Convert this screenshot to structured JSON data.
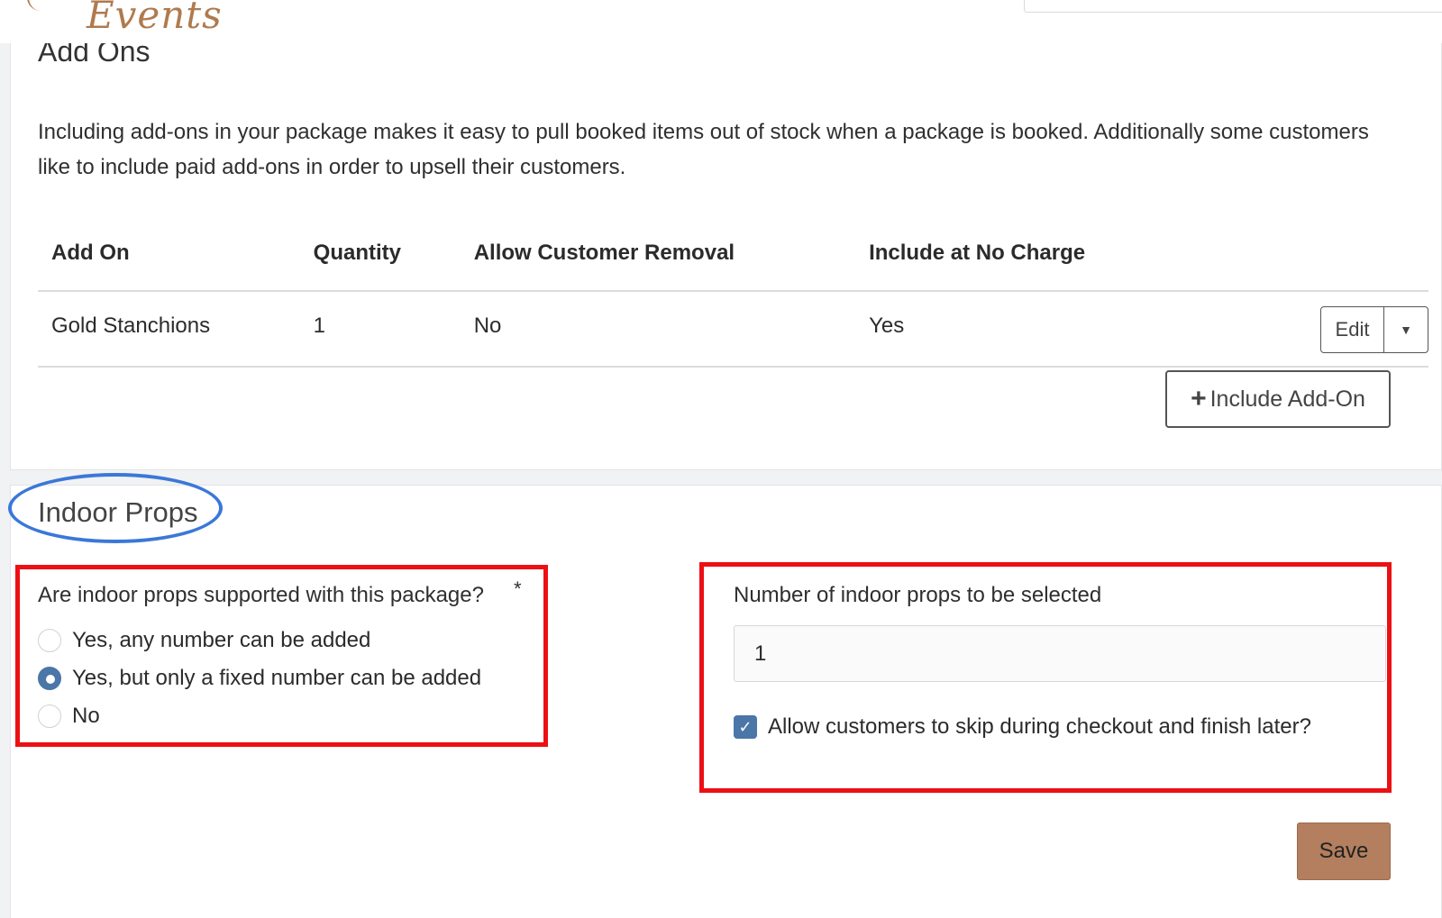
{
  "header": {
    "logo_text": "Events"
  },
  "addons": {
    "title": "Add Ons",
    "description": "Including add-ons in your package makes it easy to pull booked items out of stock when a package is booked. Additionally some customers like to include paid add-ons in order to upsell their customers.",
    "columns": [
      "Add On",
      "Quantity",
      "Allow Customer Removal",
      "Include at No Charge"
    ],
    "rows": [
      {
        "name": "Gold Stanchions",
        "quantity": "1",
        "allow_removal": "No",
        "no_charge": "Yes"
      }
    ],
    "edit_label": "Edit",
    "include_label": "Include Add-On"
  },
  "indoor_props": {
    "title": "Indoor Props",
    "question": "Are indoor props supported with this package?",
    "required_marker": "*",
    "options": [
      {
        "label": "Yes, any number can be added",
        "selected": false
      },
      {
        "label": "Yes, but only a fixed number can be added",
        "selected": true
      },
      {
        "label": "No",
        "selected": false
      }
    ],
    "number_label": "Number of indoor props to be selected",
    "number_value": "1",
    "skip_label": "Allow customers to skip during checkout and finish later?",
    "skip_checked": true,
    "save_label": "Save"
  },
  "colors": {
    "accent": "#4a76a8",
    "save_button": "#b37f5e",
    "annotation_red": "#ec1014",
    "annotation_blue": "#3a78d8"
  }
}
